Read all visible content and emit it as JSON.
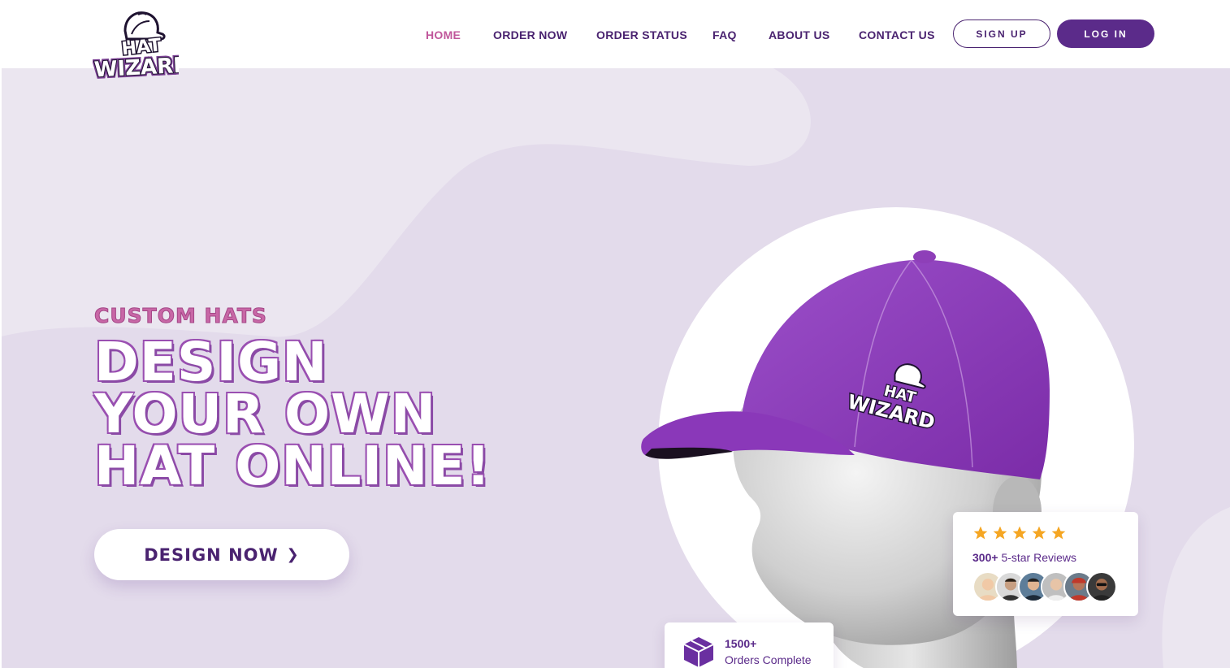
{
  "brand": {
    "logo_line1": "HAT",
    "logo_line2": "WIZARD"
  },
  "nav": {
    "items": [
      {
        "label": "HOME",
        "active": true
      },
      {
        "label": "ORDER NOW",
        "active": false
      },
      {
        "label": "ORDER STATUS",
        "active": false
      },
      {
        "label": "FAQ",
        "active": false
      },
      {
        "label": "ABOUT US",
        "active": false
      },
      {
        "label": "CONTACT US",
        "active": false
      }
    ],
    "signup_label": "SIGN UP",
    "login_label": "LOG IN"
  },
  "hero": {
    "eyebrow": "CUSTOM HATS",
    "headline_lines": [
      "DESIGN",
      "YOUR OWN",
      "HAT ONLINE!"
    ],
    "cta_label": "DESIGN NOW",
    "cta_icon": "chevron-right-icon"
  },
  "reviews": {
    "star_count": 5,
    "count": "300+",
    "label": "5-star Reviews",
    "avatar_count": 6
  },
  "orders": {
    "count": "1500+",
    "label": "Orders Complete",
    "icon": "box-icon"
  },
  "colors": {
    "primary": "#5b2b8a",
    "nav_text": "#4a2370",
    "accent_pink": "#c0569b",
    "hero_bg": "#e3dbeb",
    "hat_purple": "#8e3fb8",
    "star": "#f5a623"
  }
}
